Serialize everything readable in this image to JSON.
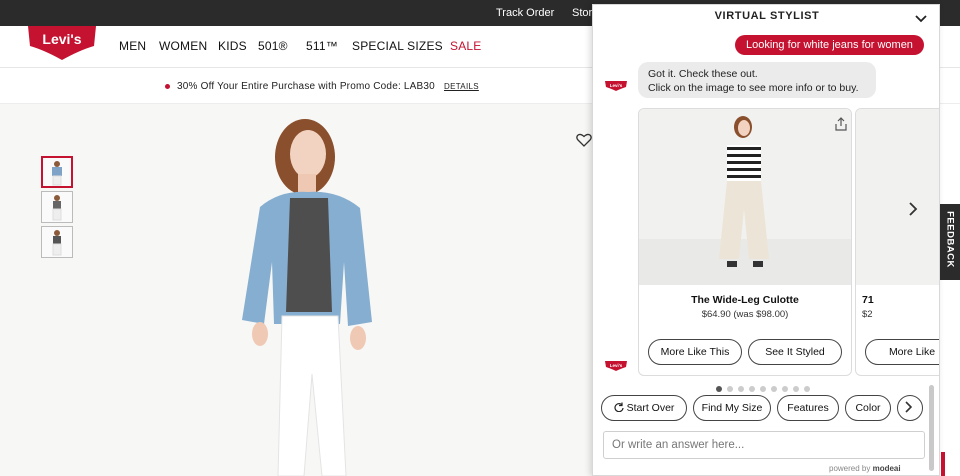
{
  "topbar": {
    "track_order": "Track Order",
    "stores": "Stor"
  },
  "logo": {
    "text": "Levi's"
  },
  "nav": {
    "items": [
      "MEN",
      "WOMEN",
      "KIDS",
      "501®",
      "511™",
      "SPECIAL SIZES"
    ],
    "sale": "SALE"
  },
  "promo": {
    "text": "30% Off Your Entire Purchase with Promo Code: LAB30",
    "details": "DETAILS"
  },
  "chat": {
    "title": "VIRTUAL STYLIST",
    "user_message": "Looking for white jeans for women",
    "bot_logo_text": "Levi's",
    "bot_message_line1": "Got it. Check these out.",
    "bot_message_line2": "Click on the image to see more info or to buy.",
    "cards": [
      {
        "name": "The Wide-Leg Culotte",
        "price": "$64.90 (was $98.00)",
        "more_like": "More Like This",
        "see_styled": "See It Styled"
      },
      {
        "name": "71",
        "price": "$2",
        "more_like": "More Like"
      }
    ],
    "carousel": {
      "page_count": 9,
      "current_page": 1
    },
    "quick_replies": [
      "Start Over",
      "Find My Size",
      "Features",
      "Color"
    ],
    "input_placeholder": "Or write an answer here...",
    "powered_by": "powered by",
    "powered_brand": "modeai"
  },
  "feedback": "FEEDBACK",
  "colors": {
    "brand_red": "#c41230",
    "dark_bar": "#2b2b2b",
    "bubble_gray": "#ebebeb"
  }
}
